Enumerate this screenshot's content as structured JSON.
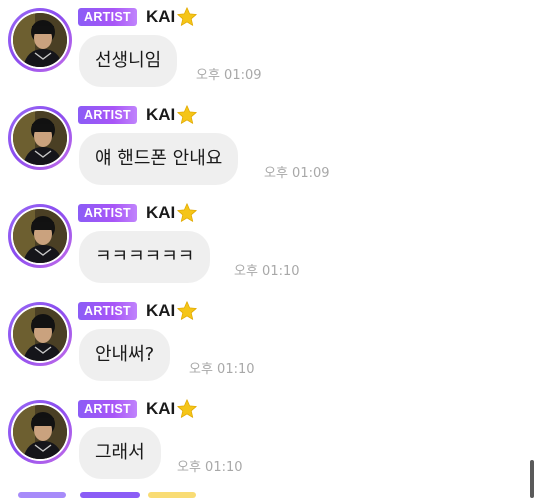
{
  "chat": {
    "messages": [
      {
        "badge": "ARTIST",
        "sender": "KAI",
        "sender_icon": "star-icon",
        "text": "선생니임",
        "time": "오후 01:09"
      },
      {
        "badge": "ARTIST",
        "sender": "KAI",
        "sender_icon": "star-icon",
        "text": "얘 핸드폰 안내요",
        "time": "오후 01:09"
      },
      {
        "badge": "ARTIST",
        "sender": "KAI",
        "sender_icon": "star-icon",
        "text": "ㅋㅋㅋㅋㅋㅋ",
        "time": "오후 01:10"
      },
      {
        "badge": "ARTIST",
        "sender": "KAI",
        "sender_icon": "star-icon",
        "text": "안내써?",
        "time": "오후 01:10"
      },
      {
        "badge": "ARTIST",
        "sender": "KAI",
        "sender_icon": "star-icon",
        "text": "그래서",
        "time": "오후 01:10"
      }
    ]
  },
  "colors": {
    "badge_gradient_start": "#8b5cf6",
    "badge_gradient_end": "#c084fc",
    "avatar_ring": "#9b6cf5",
    "bubble_background": "#efefef",
    "timestamp": "#a8a8a8",
    "star": "#f5c518"
  }
}
